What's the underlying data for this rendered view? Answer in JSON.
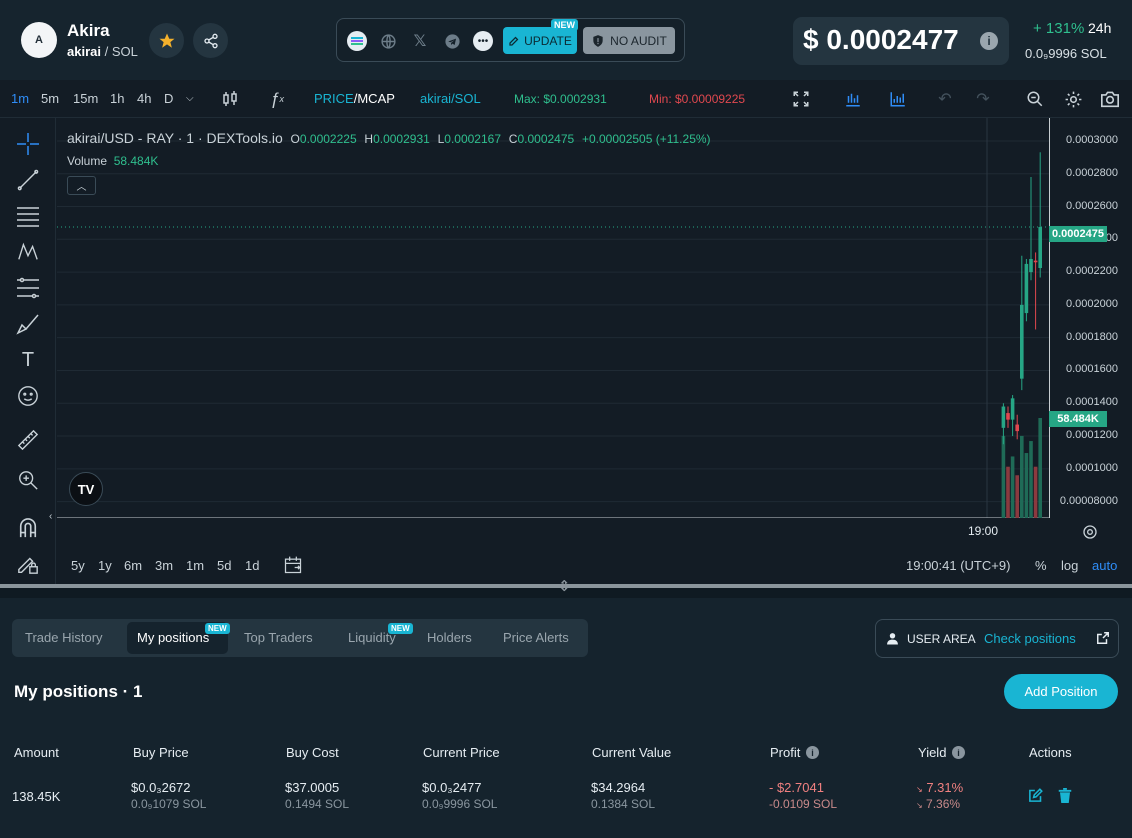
{
  "token": {
    "avatar_letter": "A",
    "name": "Akira",
    "symbol": "akirai",
    "quote": "/ SOL"
  },
  "social": {
    "update_label": "UPDATE",
    "update_badge": "NEW",
    "noaudit_label": "NO AUDIT",
    "icons": [
      "solscan-icon",
      "globe-icon",
      "x-icon",
      "telegram-icon",
      "more-icon"
    ]
  },
  "price": {
    "usd": "$ 0.0002477",
    "change": "+ 131%",
    "period": "24h",
    "sol": "0.0₉9996  SOL"
  },
  "toolbar": {
    "timeframes": [
      "1m",
      "5m",
      "15m",
      "1h",
      "4h",
      "D"
    ],
    "active_timeframe": "1m",
    "price_label": "PRICE",
    "mcap_label": "/MCAP",
    "pair_label": "akirai/SOL",
    "max_label": "Max: $0.0002931",
    "min_label": "Min: $0.00009225"
  },
  "legend": {
    "symbol": "akirai/USD - RAY · 1 · DEXTools.io",
    "o_label": "O",
    "o_val": "0.0002225",
    "h_label": "H",
    "h_val": "0.0002931",
    "l_label": "L",
    "l_val": "0.0002167",
    "c_label": "C",
    "c_val": "0.0002475",
    "change": "+0.00002505 (+11.25%)",
    "volume_label": "Volume",
    "volume_val": "58.484K"
  },
  "scale": {
    "labels": [
      "0.0003000",
      "0.0002800",
      "0.0002600",
      "0.0002400",
      "0.0002200",
      "0.0002000",
      "0.0001800",
      "0.0001600",
      "0.0001400",
      "0.0001200",
      "0.0001000",
      "0.00008000"
    ],
    "current_tag": "0.0002475",
    "volume_tag": "58.484K",
    "time_label": "19:00"
  },
  "bottombar": {
    "ranges": [
      "5y",
      "1y",
      "6m",
      "3m",
      "1m",
      "5d",
      "1d"
    ],
    "clock": "19:00:41 (UTC+9)",
    "pct": "%",
    "log": "log",
    "auto": "auto"
  },
  "colors": {
    "up": "#26a685",
    "down": "#e0484f",
    "accent": "#19b5d3"
  },
  "tabs": {
    "items": [
      "Trade History",
      "My positions",
      "Top Traders",
      "Liquidity",
      "Holders",
      "Price Alerts"
    ],
    "new_badge": "NEW",
    "active": "My positions"
  },
  "user_area": {
    "label": "USER AREA",
    "link": "Check positions"
  },
  "positions": {
    "title": "My positions · 1",
    "add_button": "Add Position",
    "headers": [
      "Amount",
      "Buy Price",
      "Buy Cost",
      "Current Price",
      "Current Value",
      "Profit",
      "Yield",
      "Actions"
    ],
    "row": {
      "amount": "138.45K",
      "buy_price": "$0.0₃2672",
      "buy_price_sol": "0.0₉1079 SOL",
      "buy_cost": "$37.0005",
      "buy_cost_sol": "0.1494 SOL",
      "current_price": "$0.0₃2477",
      "current_price_sol": "0.0₉9996 SOL",
      "current_value": "$34.2964",
      "current_value_sol": "0.1384 SOL",
      "profit": "- $2.7041",
      "profit_sol": "-0.0109 SOL",
      "yield_usd": "7.31%",
      "yield_sol": "7.36%"
    }
  },
  "chart_data": {
    "type": "candlestick",
    "candles": [
      {
        "o": 0.000125,
        "h": 0.00014,
        "l": 0.000115,
        "c": 0.000138,
        "v": 48000
      },
      {
        "o": 0.000134,
        "h": 0.000138,
        "l": 0.000125,
        "c": 0.00013,
        "v": 30000
      },
      {
        "o": 0.00013,
        "h": 0.000145,
        "l": 0.00012,
        "c": 0.000143,
        "v": 36000
      },
      {
        "o": 0.000127,
        "h": 0.000133,
        "l": 0.000118,
        "c": 0.000123,
        "v": 25000
      },
      {
        "o": 0.000155,
        "h": 0.00023,
        "l": 0.000148,
        "c": 0.0002,
        "v": 48000
      },
      {
        "o": 0.000195,
        "h": 0.000228,
        "l": 0.00019,
        "c": 0.000225,
        "v": 38000
      },
      {
        "o": 0.00022,
        "h": 0.000278,
        "l": 0.000215,
        "c": 0.000228,
        "v": 45000
      },
      {
        "o": 0.000227,
        "h": 0.000232,
        "l": 0.000185,
        "c": 0.000226,
        "v": 30000
      },
      {
        "o": 0.0002225,
        "h": 0.0002931,
        "l": 0.0002167,
        "c": 0.0002475,
        "v": 58484
      }
    ],
    "ylim": [
      7e-05,
      0.000314
    ]
  }
}
